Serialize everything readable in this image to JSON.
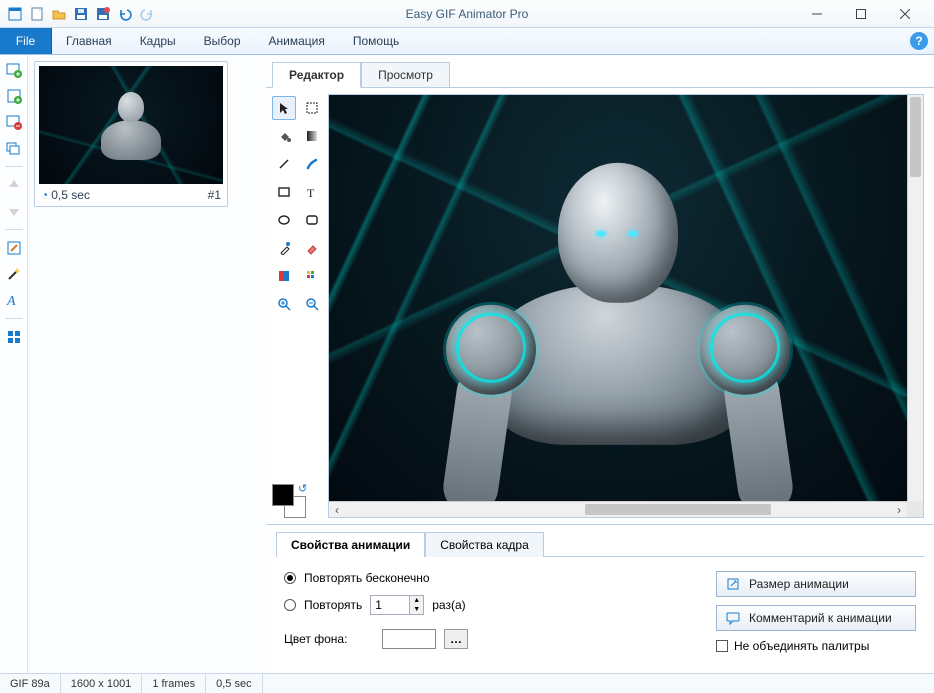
{
  "title": "Easy GIF Animator Pro",
  "menubar": {
    "file": "File",
    "items": [
      "Главная",
      "Кадры",
      "Выбор",
      "Анимация",
      "Помощь"
    ]
  },
  "frames": {
    "duration": "0,5 sec",
    "index": "#1"
  },
  "editor_tabs": {
    "editor": "Редактор",
    "preview": "Просмотр"
  },
  "props": {
    "tab_anim": "Свойства анимации",
    "tab_frame": "Свойства кадра",
    "repeat_infinite": "Повторять бесконечно",
    "repeat": "Повторять",
    "repeat_count": "1",
    "repeat_suffix": "раз(а)",
    "bg_color": "Цвет фона:",
    "btn_size": "Размер анимации",
    "btn_comment": "Комментарий к анимации",
    "chk_palettes": "Не объединять палитры"
  },
  "status": {
    "format": "GIF 89a",
    "dimensions": "1600 x 1001",
    "frames": "1 frames",
    "duration": "0,5 sec"
  }
}
